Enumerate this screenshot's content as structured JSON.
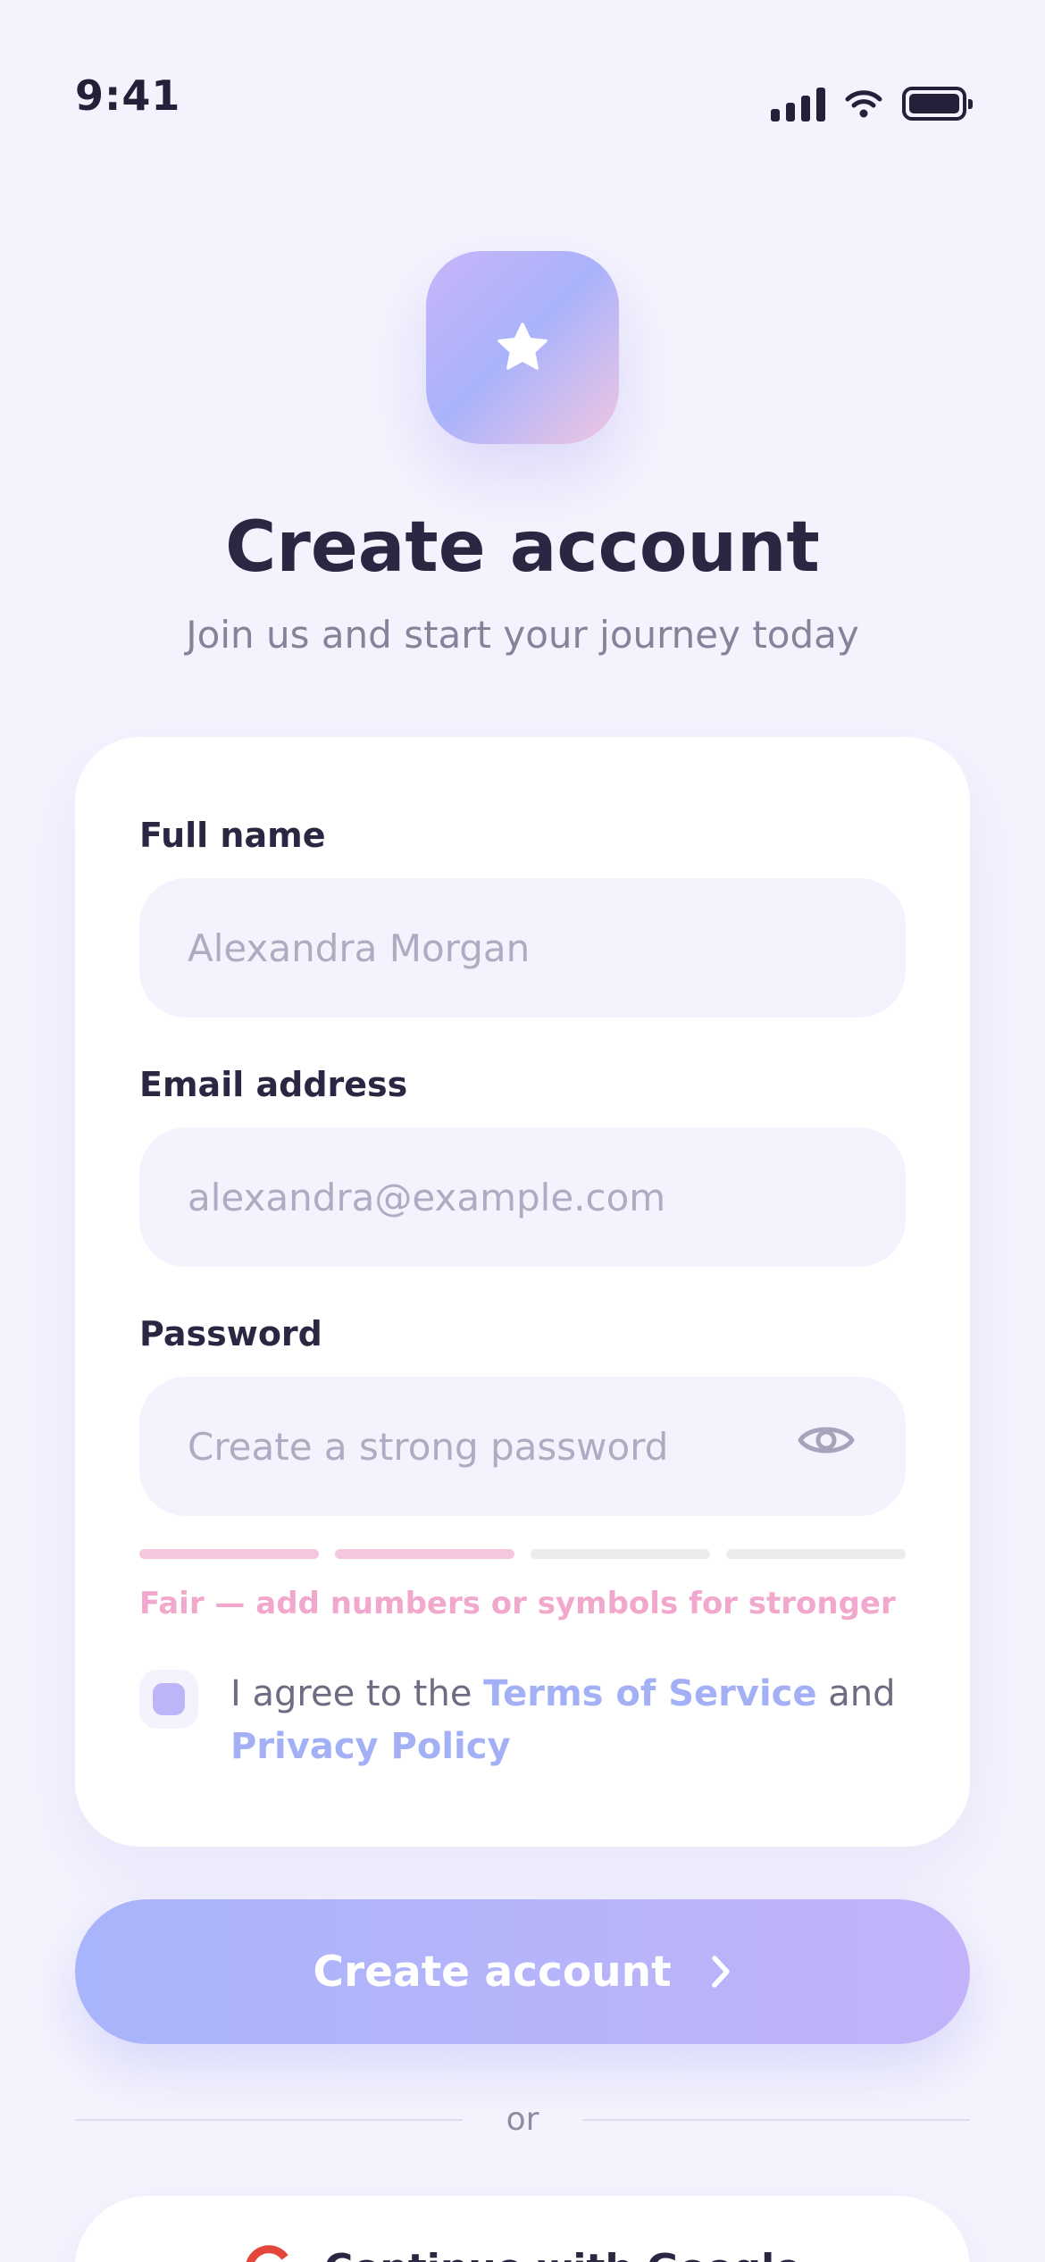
{
  "status_bar": {
    "time": "9:41"
  },
  "header": {
    "title": "Create account",
    "subtitle": "Join us and start your journey today"
  },
  "form": {
    "full_name": {
      "label": "Full name",
      "placeholder": "Alexandra Morgan",
      "value": ""
    },
    "email": {
      "label": "Email address",
      "placeholder": "alexandra@example.com",
      "value": ""
    },
    "password": {
      "label": "Password",
      "placeholder": "Create a strong password",
      "value": ""
    },
    "strength": {
      "filled_segments": 2,
      "total_segments": 4,
      "text": "Fair — add numbers or symbols for stronger"
    },
    "terms": {
      "checked": false,
      "prefix": "I agree to the ",
      "terms_link": "Terms of Service",
      "middle": " and ",
      "privacy_link": "Privacy Policy"
    }
  },
  "actions": {
    "create_label": "Create account",
    "divider_text": "or",
    "google_label": "Continue with Google"
  },
  "colors": {
    "background": "#f4f3fd",
    "accent_start": "#a8b4fb",
    "accent_end": "#c2b3fa",
    "link": "#a4b0f6",
    "strength": "#f2a8cc",
    "text": "#2a2743"
  },
  "icons": [
    "signal-icon",
    "wifi-icon",
    "battery-icon",
    "star-icon",
    "eye-icon",
    "chevron-right-icon",
    "google-icon"
  ]
}
